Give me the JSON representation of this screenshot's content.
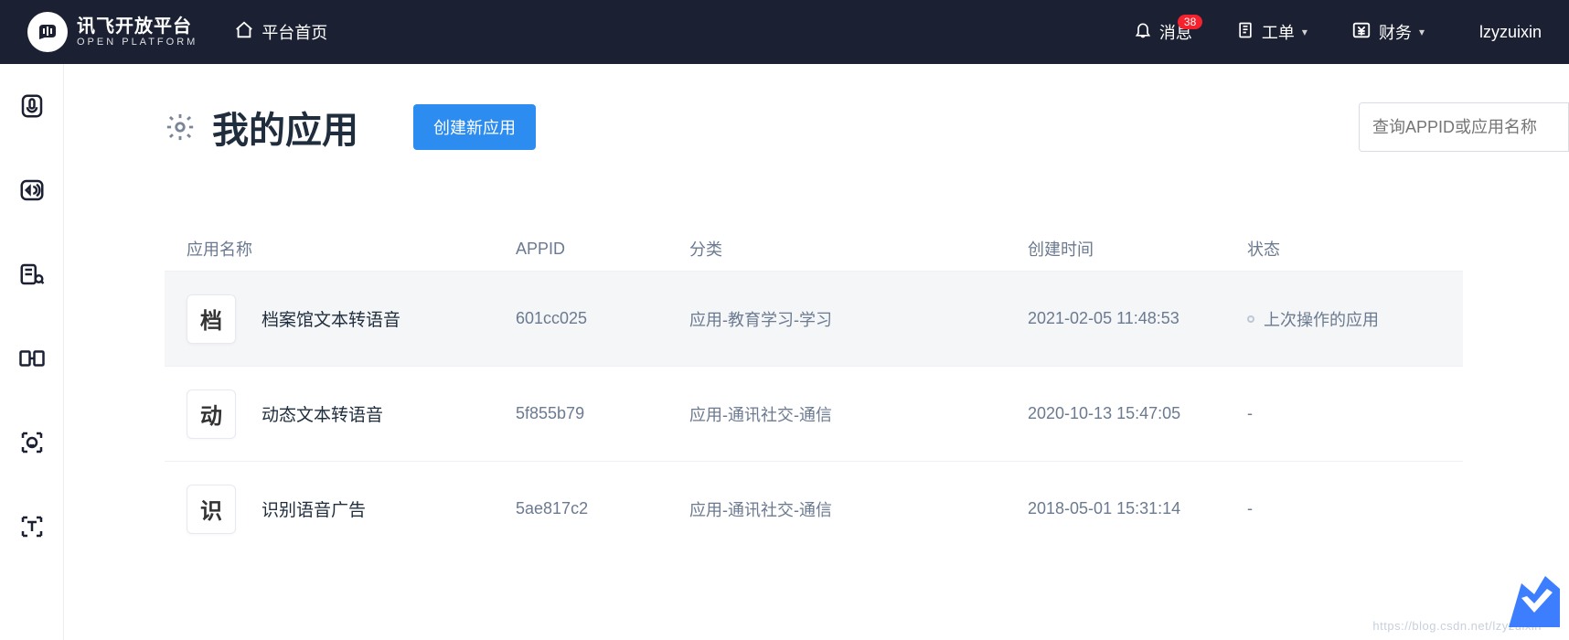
{
  "header": {
    "brand_cn": "讯飞开放平台",
    "brand_en": "OPEN PLATFORM",
    "home": "平台首页",
    "msg_label": "消息",
    "msg_count": "38",
    "ticket_label": "工单",
    "finance_label": "财务",
    "username": "lzyzuixin"
  },
  "page": {
    "title": "我的应用",
    "create_btn": "创建新应用",
    "search_placeholder": "查询APPID或应用名称"
  },
  "table": {
    "cols": {
      "name": "应用名称",
      "appid": "APPID",
      "category": "分类",
      "ctime": "创建时间",
      "status": "状态"
    },
    "rows": [
      {
        "glyph": "档",
        "name": "档案馆文本转语音",
        "appid": "601cc025",
        "category": "应用-教育学习-学习",
        "ctime": "2021-02-05 11:48:53",
        "status": "上次操作的应用",
        "selected": true
      },
      {
        "glyph": "动",
        "name": "动态文本转语音",
        "appid": "5f855b79",
        "category": "应用-通讯社交-通信",
        "ctime": "2020-10-13 15:47:05",
        "status": "-",
        "selected": false
      },
      {
        "glyph": "识",
        "name": "识别语音广告",
        "appid": "5ae817c2",
        "category": "应用-通讯社交-通信",
        "ctime": "2018-05-01 15:31:14",
        "status": "-",
        "selected": false
      }
    ]
  },
  "watermark": "https://blog.csdn.net/lzyzuixin"
}
